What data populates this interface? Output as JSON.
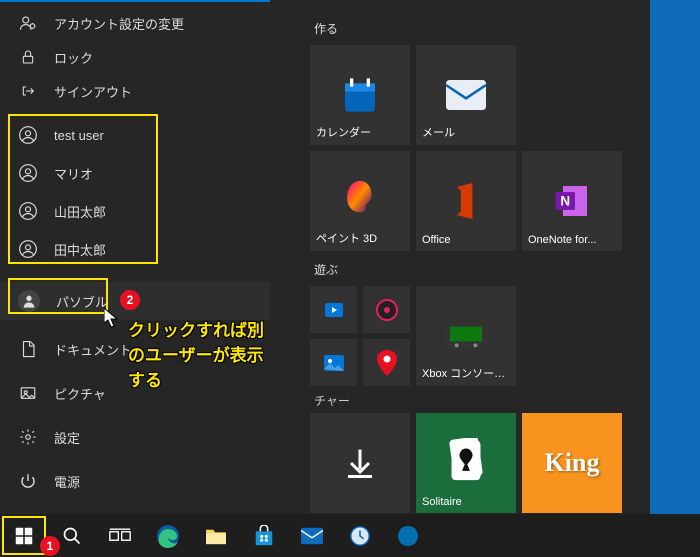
{
  "profileMenu": {
    "changeAccount": "アカウント設定の変更",
    "lock": "ロック",
    "signOut": "サインアウト"
  },
  "users": [
    "test user",
    "マリオ",
    "山田太郎",
    "田中太郎"
  ],
  "currentUser": "パソブル",
  "leftItems": {
    "documents": "ドキュメント",
    "pictures": "ピクチャ",
    "settings": "設定",
    "power": "電源"
  },
  "annotation": "クリックすれば別のユーザーが表示する",
  "badges": {
    "start": "1",
    "currentUser": "2"
  },
  "sections": {
    "make": "作る",
    "play": "遊ぶ"
  },
  "partialLetter": "チャー",
  "tiles": {
    "calendar": "カレンダー",
    "mail": "メール",
    "paint3d": "ペイント 3D",
    "office": "Office",
    "onenote": "OneNote for...",
    "xbox": "Xbox コンソール...",
    "solitaire": "Solitaire",
    "king": "King"
  }
}
